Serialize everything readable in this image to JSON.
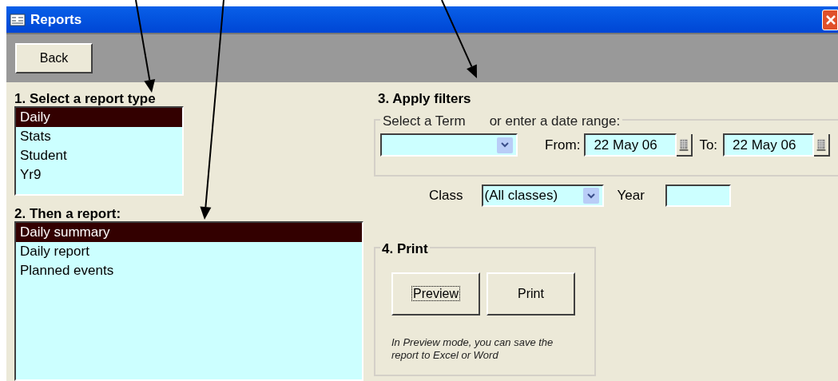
{
  "window": {
    "title": "Reports"
  },
  "toolbar": {
    "back_button": "Back"
  },
  "report_type": {
    "heading": "1. Select a report type",
    "items": [
      {
        "label": "Daily",
        "selected": true
      },
      {
        "label": "Stats",
        "selected": false
      },
      {
        "label": "Student",
        "selected": false
      },
      {
        "label": "Yr9",
        "selected": false
      }
    ]
  },
  "report": {
    "heading": "2. Then a report:",
    "items": [
      {
        "label": "Daily summary",
        "selected": true
      },
      {
        "label": "Daily report",
        "selected": false
      },
      {
        "label": "Planned events",
        "selected": false
      }
    ]
  },
  "filters": {
    "heading": "3. Apply filters",
    "term_label": "Select a Term",
    "range_label": "or enter a  date range:",
    "from_label": "From:",
    "from_value": "22 May 06",
    "to_label": "To:",
    "to_value": "22 May 06",
    "class_label": "Class",
    "class_value": "(All classes)",
    "year_label": "Year"
  },
  "print": {
    "heading": "4. Print",
    "preview_button": "Preview",
    "print_button": "Print",
    "note": "In Preview mode, you can save the report to Excel or Word"
  }
}
